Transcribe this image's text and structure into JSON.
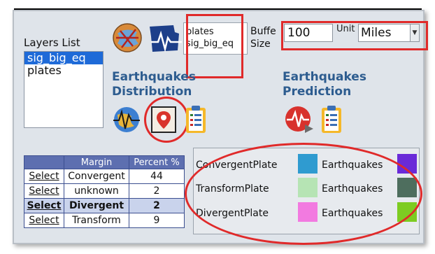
{
  "layers": {
    "label": "Layers List",
    "items": [
      "sig_big_eq",
      "plates"
    ],
    "selected": "sig_big_eq"
  },
  "selection_list": {
    "items": [
      "plates",
      "sig_big_eq"
    ]
  },
  "buffer": {
    "label_line1": "Buffe",
    "label_line2": "Size",
    "value": "100"
  },
  "unit": {
    "label": "Unit",
    "value": "Miles"
  },
  "distribution": {
    "title_line1": "Earthquakes",
    "title_line2": "Distribution"
  },
  "prediction": {
    "title_line1": "Earthquakes",
    "title_line2": "Prediction"
  },
  "table": {
    "headers": [
      "",
      "Margin",
      "Percent %"
    ],
    "rows": [
      {
        "action": "Select",
        "margin": "Convergent",
        "percent": "44",
        "bold": false
      },
      {
        "action": "Select",
        "margin": "unknown",
        "percent": "2",
        "bold": false
      },
      {
        "action": "Select",
        "margin": "Divergent",
        "percent": "2",
        "bold": true
      },
      {
        "action": "Select",
        "margin": "Transform",
        "percent": "9",
        "bold": false
      }
    ]
  },
  "legend": {
    "rows": [
      {
        "plate": "ConvergentPlate",
        "plate_color": "#2f9bd0",
        "quake": "Earthquakes",
        "quake_color": "#6a2ad8"
      },
      {
        "plate": "TransformPlate",
        "plate_color": "#b6e4b4",
        "quake": "Earthquakes",
        "quake_color": "#4e6e5e"
      },
      {
        "plate": "DivergentPlate",
        "plate_color": "#f27ae0",
        "quake": "Earthquakes",
        "quake_color": "#7dcc22"
      }
    ]
  },
  "colors": {
    "highlight_red": "#e02a2a",
    "heading_blue": "#2d5c8f",
    "selection_blue": "#1e6ad8"
  }
}
